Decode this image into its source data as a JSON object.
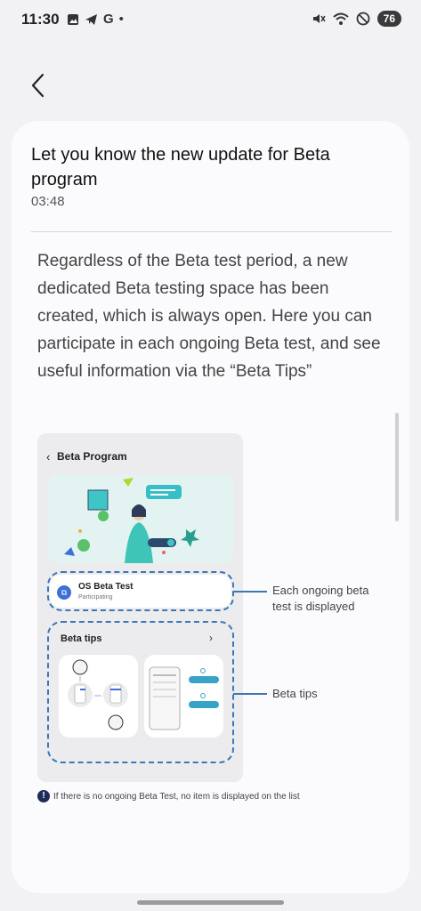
{
  "status_bar": {
    "time": "11:30",
    "battery": "76",
    "icons_left": [
      "gallery-icon",
      "telegram-icon",
      "google-icon",
      "dot-icon"
    ],
    "icons_right": [
      "mute-icon",
      "wifi-icon",
      "do-not-disturb-icon",
      "battery-icon"
    ]
  },
  "header": {
    "back_icon": "back-arrow-icon"
  },
  "message": {
    "title": "Let you know the new update for Beta program",
    "time": "03:48",
    "body": "Regardless of the Beta test period, a new dedicated Beta testing space has been created, which is always open. Here you can participate in each ongoing Beta test, and see useful information via the “Beta Tips”"
  },
  "illustration": {
    "screen_title": "Beta Program",
    "os_beta_title": "OS Beta Test",
    "os_beta_status": "Participating",
    "beta_tips_title": "Beta tips",
    "callout_1": "Each ongoing beta test is displayed",
    "callout_2": "Beta tips",
    "note": "If there is no ongoing Beta Test, no item is displayed on the list"
  },
  "colors": {
    "accent": "#3b78b8",
    "background": "#f2f2f4",
    "card": "#fbfbfd"
  }
}
